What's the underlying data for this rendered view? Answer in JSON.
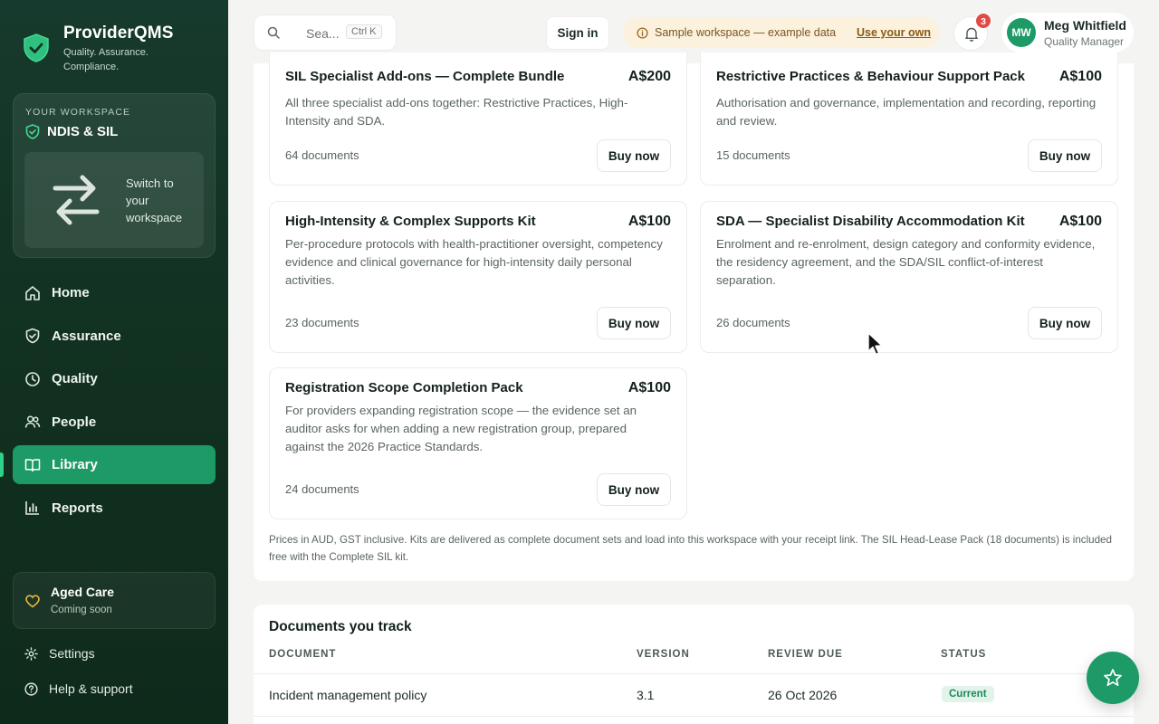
{
  "brand": {
    "name": "ProviderQMS",
    "tagline": "Quality. Assurance. Compliance."
  },
  "workspace": {
    "label": "YOUR WORKSPACE",
    "name": "NDIS & SIL",
    "switch_text": "Switch to your workspace"
  },
  "nav": {
    "items": [
      {
        "label": "Home",
        "icon": "home-icon"
      },
      {
        "label": "Assurance",
        "icon": "shield-icon"
      },
      {
        "label": "Quality",
        "icon": "clock-icon"
      },
      {
        "label": "People",
        "icon": "people-icon"
      },
      {
        "label": "Library",
        "icon": "book-icon",
        "active": true
      },
      {
        "label": "Reports",
        "icon": "bar-chart-icon"
      }
    ]
  },
  "aged_care": {
    "title": "Aged Care",
    "subtitle": "Coming soon"
  },
  "footer_links": {
    "settings": "Settings",
    "help": "Help & support"
  },
  "topbar": {
    "search_placeholder": "Sea...",
    "search_shortcut": "Ctrl K",
    "signin_label": "Sign in",
    "sample_text": "Sample workspace — example data",
    "sample_link": "Use your own",
    "notification_count": "3",
    "user": {
      "initials": "MW",
      "name": "Meg Whitfield",
      "role": "Quality Manager"
    }
  },
  "kits": [
    {
      "title": "SIL Specialist Add-ons — Complete Bundle",
      "price": "A$200",
      "description": "All three specialist add-ons together: Restrictive Practices, High-Intensity and SDA.",
      "count": "64 documents",
      "button": "Buy now"
    },
    {
      "title": "Restrictive Practices & Behaviour Support Pack",
      "price": "A$100",
      "description": "Authorisation and governance, implementation and recording, reporting and review.",
      "count": "15 documents",
      "button": "Buy now"
    },
    {
      "title": "High-Intensity & Complex Supports Kit",
      "price": "A$100",
      "description": "Per-procedure protocols with health-practitioner oversight, competency evidence and clinical governance for high-intensity daily personal activities.",
      "count": "23 documents",
      "button": "Buy now"
    },
    {
      "title": "SDA — Specialist Disability Accommodation Kit",
      "price": "A$100",
      "description": "Enrolment and re-enrolment, design category and conformity evidence, the residency agreement, and the SDA/SIL conflict-of-interest separation.",
      "count": "26 documents",
      "button": "Buy now"
    },
    {
      "title": "Registration Scope Completion Pack",
      "price": "A$100",
      "description": "For providers expanding registration scope — the evidence set an auditor asks for when adding a new registration group, prepared against the 2026 Practice Standards.",
      "count": "24 documents",
      "button": "Buy now"
    }
  ],
  "pricing_note": "Prices in AUD, GST inclusive. Kits are delivered as complete document sets and load into this workspace with your receipt link. The SIL Head-Lease Pack (18 documents) is included free with the Complete SIL kit.",
  "documents": {
    "title": "Documents you track",
    "headers": [
      "DOCUMENT",
      "VERSION",
      "REVIEW DUE",
      "STATUS"
    ],
    "rows": [
      {
        "document": "Incident management policy",
        "version": "3.1",
        "review_due": "26 Oct 2026",
        "status": "Current"
      }
    ]
  },
  "colors": {
    "sidebar": "#163a2d",
    "accent": "#1d9a66",
    "banner_bg": "#fbf1dd",
    "badge": "#e24b45"
  }
}
